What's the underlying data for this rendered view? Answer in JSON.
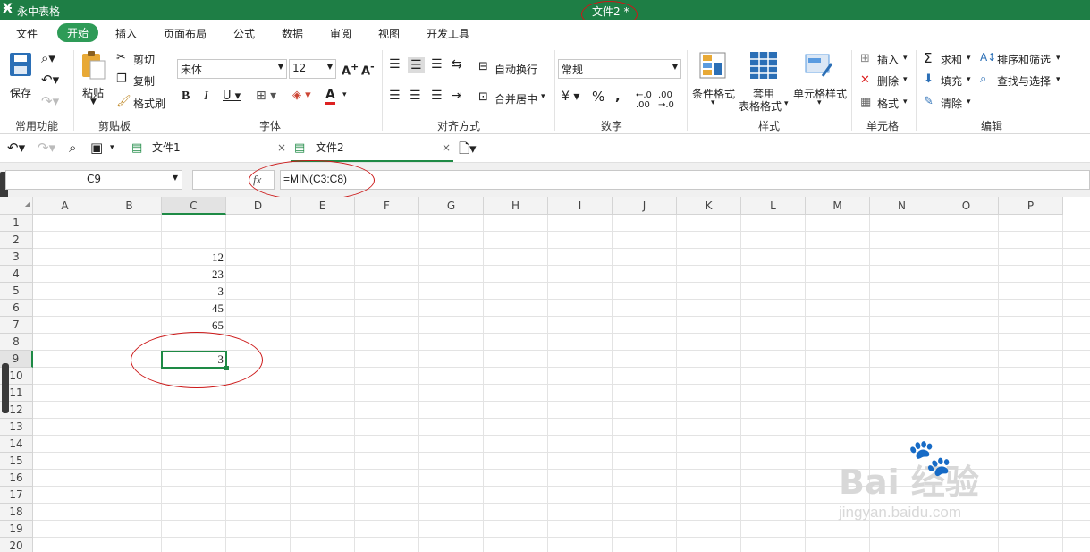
{
  "titlebar": {
    "app_title": "永中表格",
    "doc_title": "文件2 *",
    "bg": "#1e7e45"
  },
  "menu": {
    "items": [
      "文件",
      "开始",
      "插入",
      "页面布局",
      "公式",
      "数据",
      "审阅",
      "视图",
      "开发工具"
    ],
    "active": "开始"
  },
  "ribbon": {
    "save": "保存",
    "paste": "粘贴",
    "cut": "剪切",
    "copy": "复制",
    "format_painter": "格式刷",
    "font_name": "宋体",
    "font_size": "12",
    "wrap_text": "自动换行",
    "merge_center": "合并居中",
    "number_format": "常规",
    "cond_format": "条件格式",
    "table_format_1": "套用",
    "table_format_2": "表格格式",
    "cell_style": "单元格样式",
    "insert": "插入",
    "delete": "删除",
    "format": "格式",
    "sum": "求和",
    "fill": "填充",
    "clear": "清除",
    "sort_filter": "排序和筛选",
    "find_select": "查找与选择",
    "groups": {
      "common": "常用功能",
      "clipboard": "剪贴板",
      "font": "字体",
      "align": "对齐方式",
      "number": "数字",
      "style": "样式",
      "cells": "单元格",
      "edit": "编辑"
    }
  },
  "tabs": [
    {
      "label": "文件1"
    },
    {
      "label": "文件2",
      "active": true
    }
  ],
  "formula_bar": {
    "name_box": "C9",
    "fx": "fx",
    "formula": "=MIN(C3:C8)"
  },
  "sheet": {
    "columns": [
      "A",
      "B",
      "C",
      "D",
      "E",
      "F",
      "G",
      "H",
      "I",
      "J",
      "K",
      "L",
      "M",
      "N",
      "O",
      "P"
    ],
    "rows": [
      "1",
      "2",
      "3",
      "4",
      "5",
      "6",
      "7",
      "8",
      "9",
      "10",
      "11",
      "12",
      "13",
      "14",
      "15",
      "16",
      "17",
      "18",
      "19",
      "20"
    ],
    "c_values": [
      {
        "row": "3",
        "value": "12"
      },
      {
        "row": "4",
        "value": "23"
      },
      {
        "row": "5",
        "value": "3"
      },
      {
        "row": "6",
        "value": "45"
      },
      {
        "row": "7",
        "value": "65"
      },
      {
        "row": "9",
        "value": "3"
      }
    ],
    "selected_cell": "C9"
  },
  "watermark": {
    "brand": "Bai  经验",
    "url": "jingyan.baidu.com"
  },
  "colors": {
    "accent": "#1e8a45",
    "annotation": "#cc1818"
  }
}
